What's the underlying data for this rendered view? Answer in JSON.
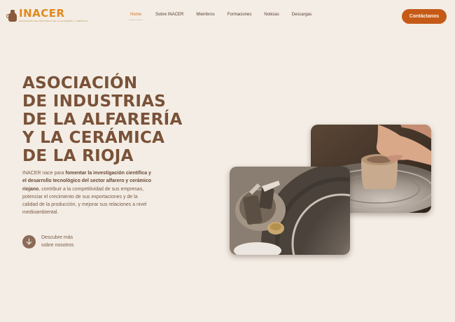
{
  "header": {
    "logo": {
      "name": "INACER",
      "tagline": "ASOCIACIÓN DE INDUSTRIAS DE LA ALFARERÍA Y CERÁMICA",
      "icon": "pottery-jar-icon"
    },
    "nav": [
      {
        "label": "Home",
        "active": true
      },
      {
        "label": "Sobre INACER",
        "active": false
      },
      {
        "label": "Miembros",
        "active": false
      },
      {
        "label": "Formaciones",
        "active": false
      },
      {
        "label": "Noticias",
        "active": false
      },
      {
        "label": "Descargas",
        "active": false
      }
    ],
    "cta_label": "Contáctanos"
  },
  "hero": {
    "title_lines": [
      "ASOCIACIÓN",
      "DE INDUSTRIAS",
      "DE LA ALFARERÍA",
      "Y LA CERÁMICA",
      "DE LA RIOJA"
    ],
    "text": {
      "p1": "INACER nace para ",
      "b1": "fomentar la investigación científica y el desarrollo tecnológico del sector alfarero y cerámico riojano",
      "p2": ", contribuir a la competitividad de sus empresas, potenciar el crecimiento de sus exportaciones y de la calidad de la producción, y mejorar sus relaciones a nivel medioambiental."
    },
    "discover": {
      "line1": "Descubre más",
      "line2": "sobre nosotros",
      "icon": "arrow-down-icon"
    }
  },
  "colors": {
    "background": "#f3ede5",
    "accent": "#c55a17",
    "logo": "#e08a1e",
    "heading": "#7a5238"
  }
}
